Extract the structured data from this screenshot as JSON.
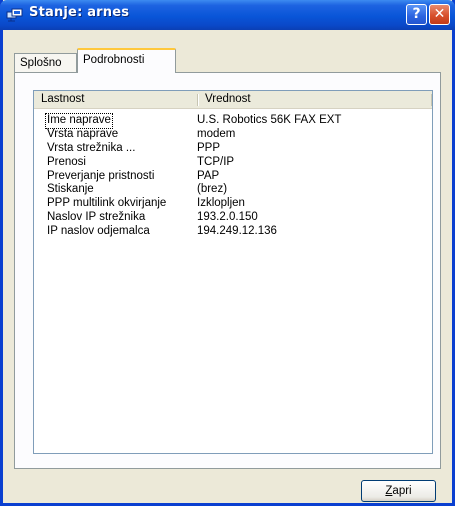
{
  "window": {
    "title": "Stanje: arnes",
    "help_glyph": "?",
    "close_glyph": "✕",
    "icon": "network-connection-icon"
  },
  "tabs": [
    {
      "label": "Splošno",
      "active": false
    },
    {
      "label": "Podrobnosti",
      "active": true
    }
  ],
  "details": {
    "columns": [
      "Lastnost",
      "Vrednost"
    ],
    "rows": [
      {
        "property": "Ime naprave",
        "value": "U.S. Robotics 56K FAX EXT"
      },
      {
        "property": "Vrsta naprave",
        "value": "modem"
      },
      {
        "property": "Vrsta strežnika ...",
        "value": "PPP"
      },
      {
        "property": "Prenosi",
        "value": "TCP/IP"
      },
      {
        "property": "Preverjanje pristnosti",
        "value": "PAP"
      },
      {
        "property": "Stiskanje",
        "value": "(brez)"
      },
      {
        "property": "PPP multilink okvirjanje",
        "value": "Izklopljen"
      },
      {
        "property": "Naslov IP strežnika",
        "value": "193.2.0.150"
      },
      {
        "property": "IP naslov odjemalca",
        "value": "194.249.12.136"
      }
    ]
  },
  "close_button": {
    "mnemonic": "Z",
    "rest": "apri"
  },
  "colors": {
    "titlebar": "#0955d8",
    "close": "#d8512d",
    "active_tab_accent": "#ffc83c",
    "dialog_bg": "#ece9d8"
  }
}
